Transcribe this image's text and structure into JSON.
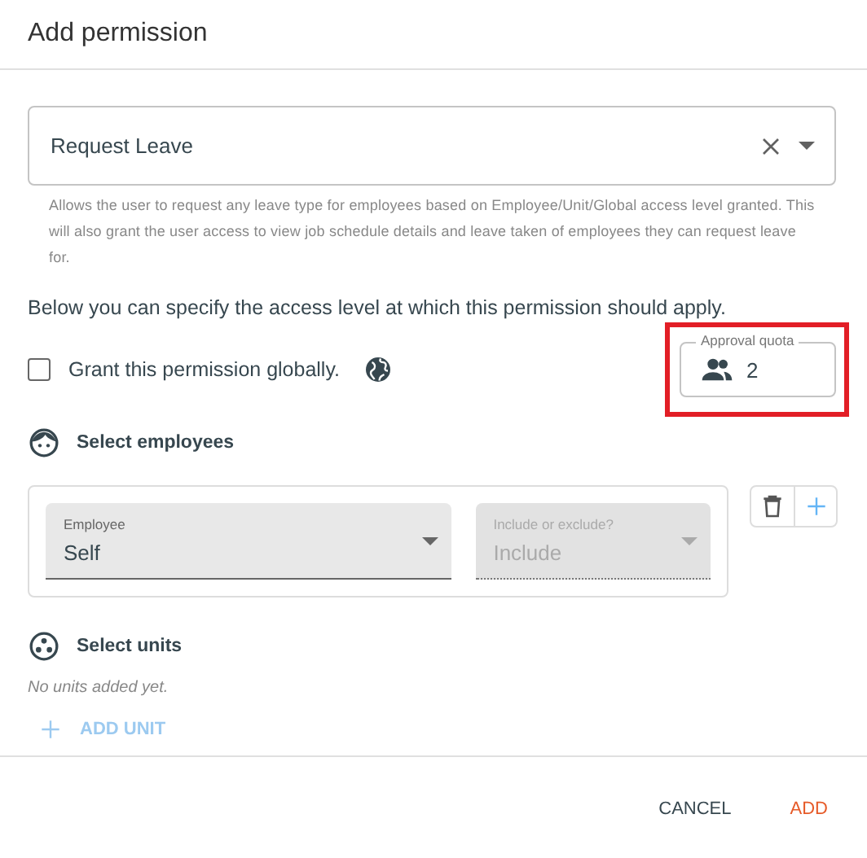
{
  "dialog": {
    "title": "Add permission"
  },
  "permission": {
    "value": "Request Leave",
    "help": "Allows the user to request any leave type for employees based on Employee/Unit/Global access level granted. This will also grant the user access to view job schedule details and leave taken of employees they can request leave for."
  },
  "intro": "Below you can specify the access level at which this permission should apply.",
  "global": {
    "label": "Grant this permission globally.",
    "checked": false
  },
  "approval_quota": {
    "label": "Approval quota",
    "value": "2",
    "highlighted": true
  },
  "employees": {
    "heading": "Select employees",
    "rows": [
      {
        "employee": {
          "label": "Employee",
          "value": "Self",
          "disabled": false
        },
        "mode": {
          "label": "Include or exclude?",
          "value": "Include",
          "disabled": true
        }
      }
    ]
  },
  "units": {
    "heading": "Select units",
    "empty": "No units added yet.",
    "add_button": {
      "label": "ADD UNIT",
      "disabled": true
    }
  },
  "actions": [
    {
      "label": "CANCEL",
      "kind": "secondary"
    },
    {
      "label": "ADD",
      "kind": "primary"
    }
  ]
}
